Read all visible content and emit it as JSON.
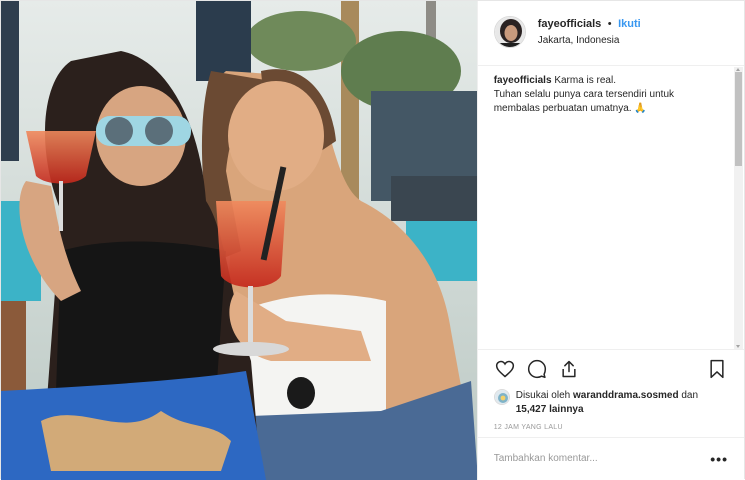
{
  "post": {
    "username": "fayeofficials",
    "separator": "•",
    "follow_label": "Ikuti",
    "location": "Jakarta, Indonesia",
    "caption_user": "fayeofficials",
    "caption_text": "Karma is real.\nTuhan selalu punya cara tersendiri untuk membalas perbuatan umatnya. 🙏",
    "liked_by_prefix": "Disukai oleh ",
    "liked_by_user": "waranddrama.sosmed",
    "liked_by_and": " dan",
    "likes_count": "15,427",
    "likes_suffix": " lainnya",
    "timestamp": "12 JAM YANG LALU",
    "comment_placeholder": "Tambahkan komentar...",
    "more_label": "•••"
  },
  "icons": {
    "like": "heart-icon",
    "comment": "comment-icon",
    "share": "share-icon",
    "save": "bookmark-icon"
  },
  "colors": {
    "follow": "#3897f0",
    "text": "#262626",
    "muted": "#999999",
    "border": "#efefef"
  }
}
